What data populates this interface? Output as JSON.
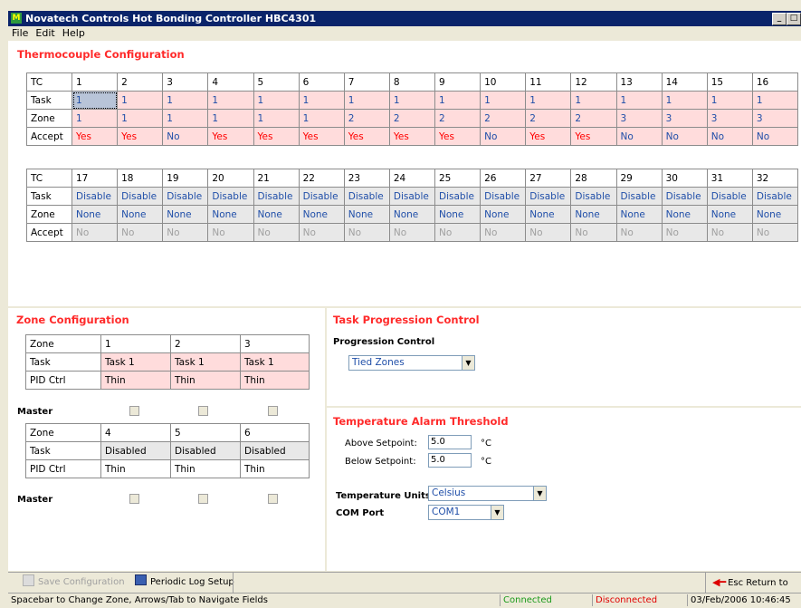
{
  "window": {
    "title": "Novatech Controls Hot Bonding Controller HBC4301",
    "icon": "app-icon"
  },
  "menu": [
    "File",
    "Edit",
    "Help"
  ],
  "thermocouple": {
    "title": "Thermocouple Configuration",
    "row_labels": [
      "TC",
      "Task",
      "Zone",
      "Accept"
    ],
    "grid1": {
      "tc": [
        "1",
        "2",
        "3",
        "4",
        "5",
        "6",
        "7",
        "8",
        "9",
        "10",
        "11",
        "12",
        "13",
        "14",
        "15",
        "16"
      ],
      "task": [
        "1",
        "1",
        "1",
        "1",
        "1",
        "1",
        "1",
        "1",
        "1",
        "1",
        "1",
        "1",
        "1",
        "1",
        "1",
        "1"
      ],
      "zone": [
        "1",
        "1",
        "1",
        "1",
        "1",
        "1",
        "2",
        "2",
        "2",
        "2",
        "2",
        "2",
        "3",
        "3",
        "3",
        "3"
      ],
      "accept": [
        "Yes",
        "Yes",
        "No",
        "Yes",
        "Yes",
        "Yes",
        "Yes",
        "Yes",
        "Yes",
        "No",
        "Yes",
        "Yes",
        "No",
        "No",
        "No",
        "No"
      ]
    },
    "grid2": {
      "tc": [
        "17",
        "18",
        "19",
        "20",
        "21",
        "22",
        "23",
        "24",
        "25",
        "26",
        "27",
        "28",
        "29",
        "30",
        "31",
        "32"
      ],
      "task": [
        "Disable",
        "Disable",
        "Disable",
        "Disable",
        "Disable",
        "Disable",
        "Disable",
        "Disable",
        "Disable",
        "Disable",
        "Disable",
        "Disable",
        "Disable",
        "Disable",
        "Disable",
        "Disable"
      ],
      "zone": [
        "None",
        "None",
        "None",
        "None",
        "None",
        "None",
        "None",
        "None",
        "None",
        "None",
        "None",
        "None",
        "None",
        "None",
        "None",
        "None"
      ],
      "accept": [
        "No",
        "No",
        "No",
        "No",
        "No",
        "No",
        "No",
        "No",
        "No",
        "No",
        "No",
        "No",
        "No",
        "No",
        "No",
        "No"
      ]
    }
  },
  "zone_config": {
    "title": "Zone Configuration",
    "row_labels": [
      "Zone",
      "Task",
      "PID Ctrl"
    ],
    "master_label": "Master",
    "grid1": {
      "zone": [
        "1",
        "2",
        "3"
      ],
      "task": [
        "Task 1",
        "Task 1",
        "Task 1"
      ],
      "pid": [
        "Thin",
        "Thin",
        "Thin"
      ]
    },
    "grid2": {
      "zone": [
        "4",
        "5",
        "6"
      ],
      "task": [
        "Disabled",
        "Disabled",
        "Disabled"
      ],
      "pid": [
        "Thin",
        "Thin",
        "Thin"
      ]
    }
  },
  "task_progression": {
    "title": "Task Progression Control",
    "label": "Progression Control",
    "value": "Tied Zones"
  },
  "alarm": {
    "title": "Temperature Alarm Threshold",
    "above_label": "Above Setpoint:",
    "above_value": "5.0",
    "below_label": "Below Setpoint:",
    "below_value": "5.0",
    "unit": "°C",
    "units_label": "Temperature Units",
    "units_value": "Celsius",
    "com_label": "COM Port",
    "com_value": "COM1"
  },
  "toolbar": {
    "save_label": "Save Configuration",
    "log_label": "Periodic Log Setup",
    "return_label": "Esc Return to Menu"
  },
  "status": {
    "hint": "Spacebar to Change Zone, Arrows/Tab to Navigate Fields",
    "connected": "Connected",
    "disconnected": "Disconnected",
    "datetime": "03/Feb/2006  10:46:45"
  },
  "colors": {
    "title_red": "#ff2b2b",
    "pink_row": "#ffdcdc",
    "value_blue": "#1f4ea8",
    "connected_green": "#1a9a1a",
    "titlebar": "#0a246a"
  }
}
